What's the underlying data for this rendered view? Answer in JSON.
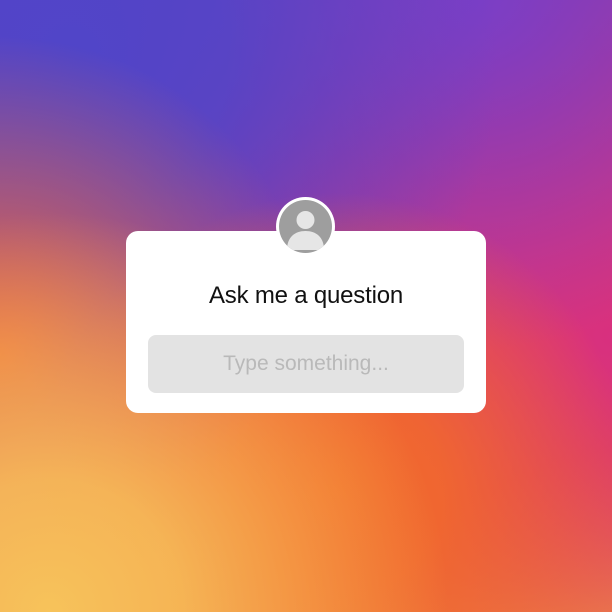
{
  "sticker": {
    "title": "Ask me a question",
    "input": {
      "value": "",
      "placeholder": "Type something..."
    },
    "avatar_icon": "default-user-avatar-icon"
  },
  "colors": {
    "card": "#ffffff",
    "input_bg": "#e3e3e3",
    "placeholder": "#b9b9b9",
    "title_text": "#111111",
    "avatar_bg": "#9e9e9e",
    "gradient_purple": "#5045c8",
    "gradient_pink": "#d8307f",
    "gradient_orange": "#f26b2a",
    "gradient_yellow": "#f7c35a"
  }
}
